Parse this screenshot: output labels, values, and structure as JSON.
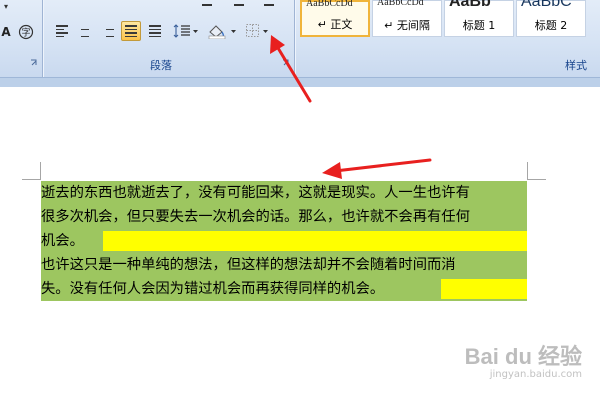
{
  "ribbon": {
    "paragraph_group_label": "段落",
    "styles_group_label": "样式",
    "styles": [
      {
        "sample": "AaBbCcDd",
        "name": "正文",
        "prefix": "↵"
      },
      {
        "sample": "AaBbCcDd",
        "name": "无间隔",
        "prefix": "↵"
      },
      {
        "sample": "AaBb",
        "name": "标题 1",
        "prefix": ""
      },
      {
        "sample": "AaBbC",
        "name": "标题 2",
        "prefix": ""
      }
    ],
    "left_icons": [
      "font-a-icon",
      "phonetic-guide-icon"
    ]
  },
  "document": {
    "lines": [
      "逝去的东西也就逝去了，没有可能回来，这就是现实。人一生也许有",
      "很多次机会，但只要失去一次机会的话。那么，也许就不会再有任何",
      "机会。",
      "也许这只是一种单纯的想法，但这样的想法却并不会随着时间而消",
      "失。没有任何人会因为错过机会而再获得同样的机会。"
    ]
  },
  "watermark": {
    "main": "Bai du 经验",
    "sub": "jingyan.baidu.com"
  },
  "colors": {
    "green_shading": "#9dc660",
    "yellow_highlight": "#ffff00",
    "arrow_red": "#e8201f",
    "ribbon_text": "#15428b"
  }
}
